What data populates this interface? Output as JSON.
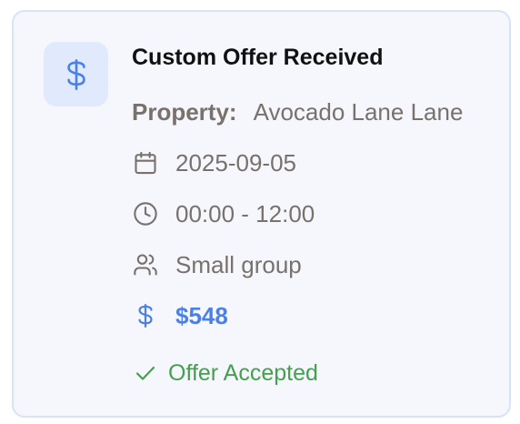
{
  "offer": {
    "title": "Custom Offer Received",
    "property_label": "Property:",
    "property_value": "Avocado Lane Lane",
    "date": "2025-09-05",
    "time": "00:00 - 12:00",
    "group": "Small group",
    "price": "$548",
    "status": "Offer Accepted"
  },
  "colors": {
    "accent": "#4a80e8",
    "success": "#45a04e",
    "muted": "#78716c"
  }
}
